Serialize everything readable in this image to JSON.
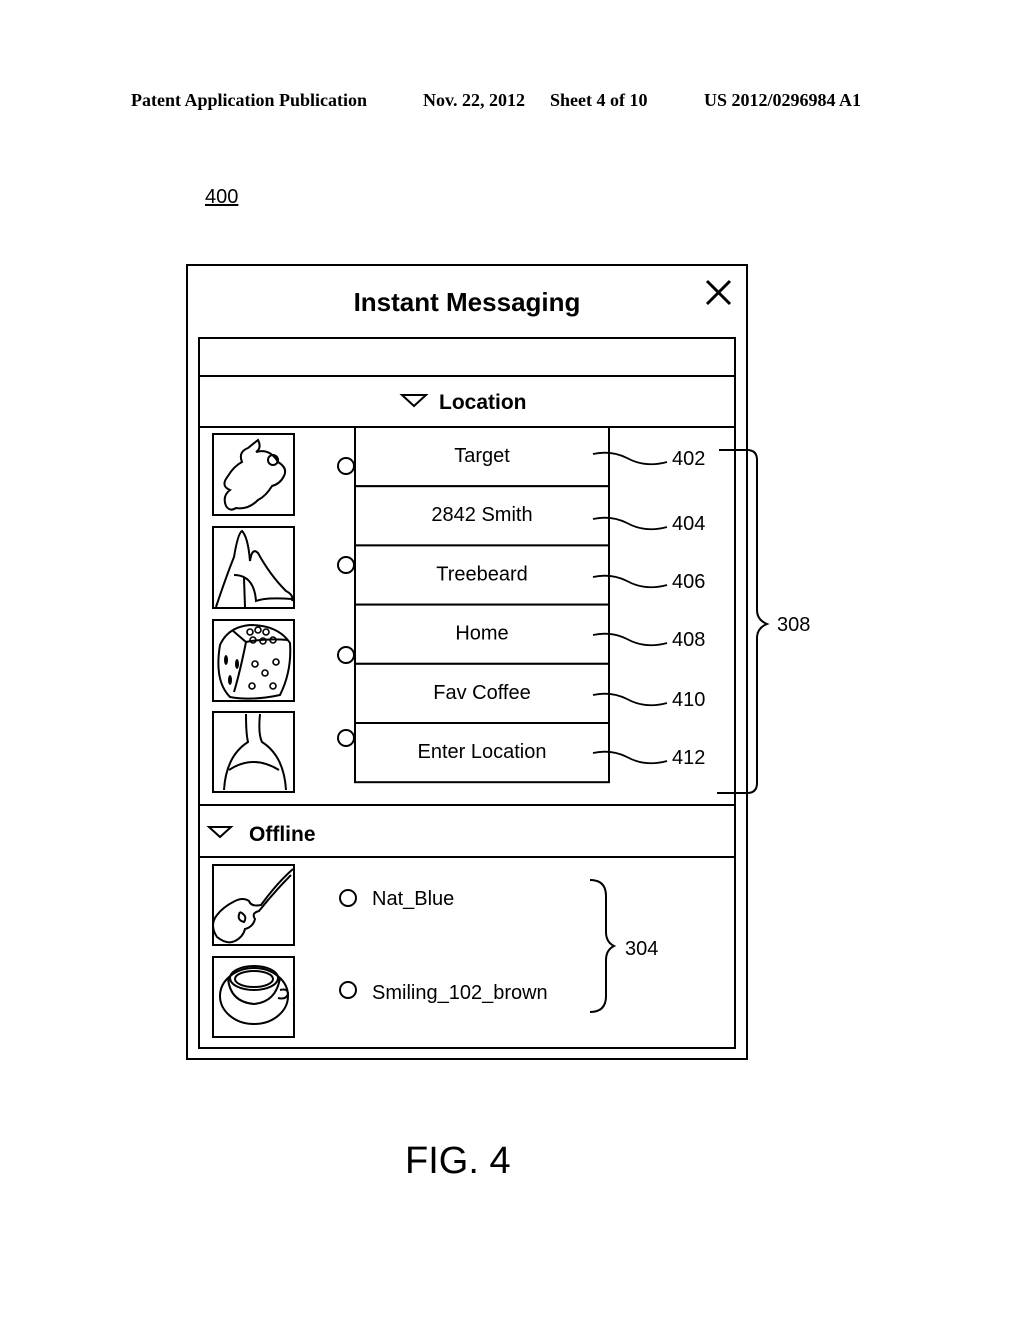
{
  "header": {
    "publication_type": "Patent Application Publication",
    "date": "Nov. 22, 2012",
    "sheet": "Sheet 4 of 10",
    "patent_number": "US 2012/0296984 A1"
  },
  "figure_ref": "400",
  "window": {
    "title": "Instant Messaging",
    "close_icon": "close-icon"
  },
  "groups": {
    "location": {
      "label": "Location",
      "icon": "triangle-down-icon",
      "avatars": [
        "astronaut-icon",
        "mountain-icon",
        "dice-icon",
        "spoon-icon"
      ],
      "menu": [
        {
          "label": "Target",
          "ref": "402"
        },
        {
          "label": "2842 Smith",
          "ref": "404"
        },
        {
          "label": "Treebeard",
          "ref": "406"
        },
        {
          "label": "Home",
          "ref": "408"
        },
        {
          "label": "Fav Coffee",
          "ref": "410"
        },
        {
          "label": "Enter Location",
          "ref": "412"
        }
      ],
      "bracket_ref": "308"
    },
    "offline": {
      "label": "Offline",
      "icon": "triangle-down-icon",
      "contacts": [
        {
          "name": "Nat_Blue",
          "avatar": "guitar-icon"
        },
        {
          "name": "Smiling_102_brown",
          "avatar": "teacup-icon"
        }
      ],
      "bracket_ref": "304"
    }
  },
  "caption": "FIG. 4"
}
